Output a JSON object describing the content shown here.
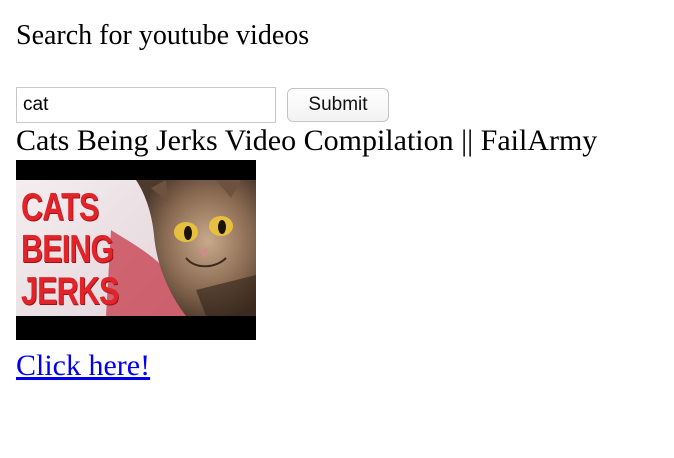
{
  "header": {
    "title": "Search for youtube videos"
  },
  "search": {
    "value": "cat",
    "submit_label": "Submit"
  },
  "result": {
    "title": "Cats Being Jerks Video Compilation || FailArmy",
    "thumbnail_text": [
      "CATS",
      "BEING",
      "JERKS"
    ],
    "thumbnail_icon": "cat-photo",
    "link_text": "Click here!"
  },
  "colors": {
    "link": "#0000ee",
    "thumbnail_text": "#e0242a",
    "thumbnail_border": "#000000"
  }
}
